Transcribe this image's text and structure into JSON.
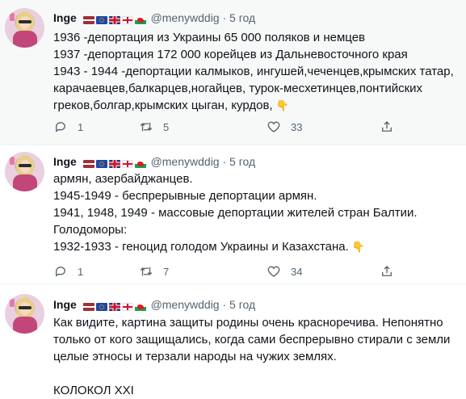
{
  "tweets": [
    {
      "author": "Inge",
      "flags": [
        "flag-latvia",
        "flag-eu",
        "flag-uk",
        "flag-england",
        "flag-wales"
      ],
      "handle": "@menywddig",
      "separator": "·",
      "time": "5 год",
      "lines": [
        "1936 -депортация из Украины 65 000 поляков и немцев",
        "1937 -депортация 172 000 корейцев из Дальневосточного края",
        "1943 - 1944 -депортации калмыков, ингушей,чеченцев,крымских татар,",
        "карачаевцев,балкарцев,ногайцев, турок-месхетинцев,понтийских",
        "греков,болгар,крымских цыган, курдов,"
      ],
      "emoji": "👇",
      "replies": "1",
      "retweets": "5",
      "likes": "33"
    },
    {
      "author": "Inge",
      "flags": [
        "flag-latvia",
        "flag-eu",
        "flag-uk",
        "flag-england",
        "flag-wales"
      ],
      "handle": "@menywddig",
      "separator": "·",
      "time": "5 год",
      "lines": [
        "армян, азербайджанцев.",
        "1945-1949 - беспрерывные депортации армян.",
        "1941, 1948, 1949 - массовые депортации жителей стран Балтии.",
        "Голодоморы:",
        "1932-1933 - геноцид голодом Украины и Казахстана."
      ],
      "emoji": "👇",
      "replies": "1",
      "retweets": "7",
      "likes": "34"
    },
    {
      "author": "Inge",
      "flags": [
        "flag-latvia",
        "flag-eu",
        "flag-uk",
        "flag-england",
        "flag-wales"
      ],
      "handle": "@menywddig",
      "separator": "·",
      "time": "5 год",
      "lines": [
        "Как видите, картина защиты родины очень красноречива. Непонятно",
        "только от кого защищались, когда сами беспрерывно стирали с земли",
        "целые этносы и терзали народы на чужих землях.",
        "",
        "КОЛОКОЛ XXI"
      ]
    }
  ]
}
